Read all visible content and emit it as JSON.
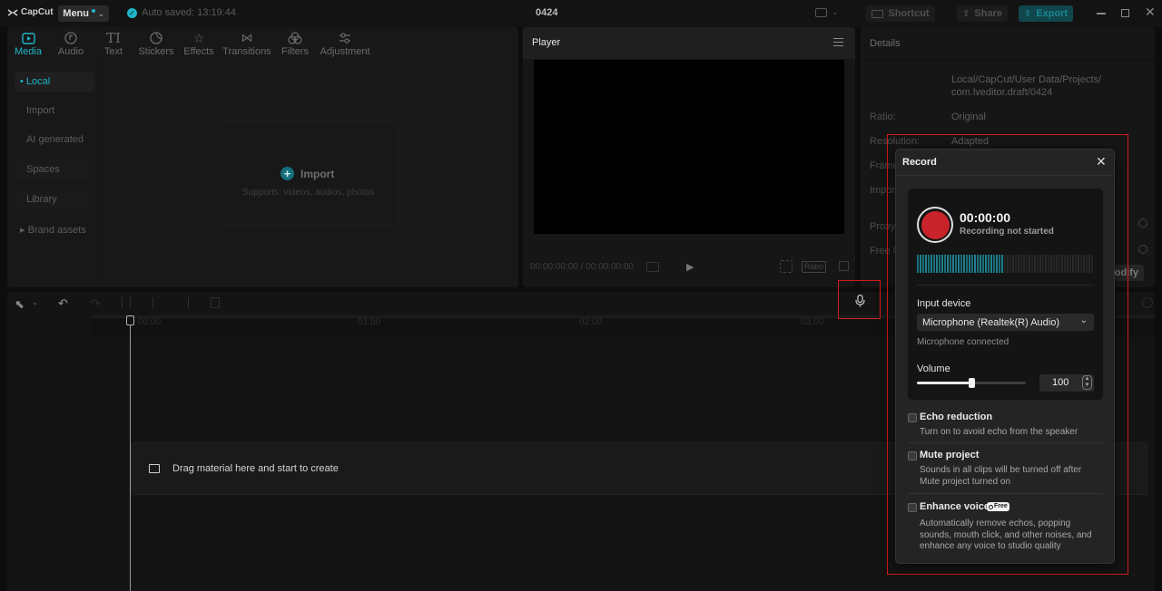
{
  "titlebar": {
    "app_name": "CapCut",
    "menu_label": "Menu",
    "autosave_text": "Auto saved: 13:19:44",
    "project_name": "0424",
    "shortcut_label": "Shortcut",
    "share_label": "Share",
    "export_label": "Export"
  },
  "media": {
    "tabs": [
      {
        "label": "Media",
        "icon": "media-icon"
      },
      {
        "label": "Audio",
        "icon": "audio-icon"
      },
      {
        "label": "Text",
        "icon": "text-icon"
      },
      {
        "label": "Stickers",
        "icon": "stickers-icon"
      },
      {
        "label": "Effects",
        "icon": "effects-icon"
      },
      {
        "label": "Transitions",
        "icon": "transitions-icon"
      },
      {
        "label": "Filters",
        "icon": "filters-icon"
      },
      {
        "label": "Adjustment",
        "icon": "adjustment-icon"
      }
    ],
    "sidebar": [
      "• Local",
      "Import",
      "AI generated",
      "Spaces",
      "Library",
      "▸ Brand assets"
    ],
    "import_label": "Import",
    "import_hint": "Supports: videos, audios, photos"
  },
  "player": {
    "title": "Player",
    "timecode": "00:00:00:00 / 00:00:00:00",
    "ratio_label": "Ratio"
  },
  "details": {
    "title": "Details",
    "path": "Local/CapCut/User Data/Projects/\ncom.lveditor.draft/0424",
    "rows": [
      {
        "label": "Ratio:",
        "value": "Original"
      },
      {
        "label": "Resolution:",
        "value": "Adapted"
      },
      {
        "label": "Frame",
        "value": ""
      },
      {
        "label": "Impor",
        "value": ""
      },
      {
        "label": "Proxy",
        "value": ""
      },
      {
        "label": "Free l",
        "value": ""
      }
    ],
    "modify_label": "odify"
  },
  "timeline": {
    "ruler_ticks": [
      "00:00",
      "01:00",
      "02:00",
      "03:00"
    ],
    "drop_hint": "Drag material here and start to create"
  },
  "record": {
    "title": "Record",
    "time": "00:00:00",
    "status": "Recording not started",
    "input_label": "Input device",
    "device": "Microphone (Realtek(R) Audio)",
    "device_status": "Microphone connected",
    "volume_label": "Volume",
    "volume_value": "100",
    "volume_level": 0.5,
    "options": [
      {
        "title": "Echo reduction",
        "desc": "Turn on to avoid echo from the speaker",
        "badge": ""
      },
      {
        "title": "Mute project",
        "desc": "Sounds in all clips will be turned off after Mute project turned on",
        "badge": ""
      },
      {
        "title": "Enhance voice",
        "desc": "Automatically remove echos, popping sounds, mouth click, and other noises, and enhance any voice to studio quality",
        "badge": "Free"
      }
    ]
  },
  "colors": {
    "accent": "#1fb5c9",
    "record_red": "#c8232b",
    "highlight": "#d51b1b"
  }
}
